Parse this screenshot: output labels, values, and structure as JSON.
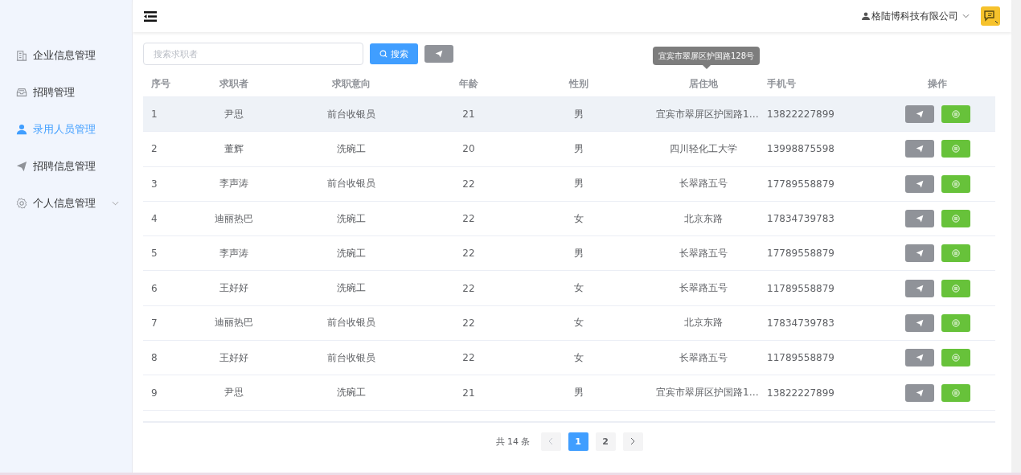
{
  "sidebar": {
    "items": [
      {
        "label": "企业信息管理",
        "selected": false
      },
      {
        "label": "招聘管理",
        "selected": false
      },
      {
        "label": "录用人员管理",
        "selected": true
      },
      {
        "label": "招聘信息管理",
        "selected": false
      },
      {
        "label": "个人信息管理",
        "selected": false,
        "expanded": false
      }
    ]
  },
  "header": {
    "company": "格陆博科技有限公司"
  },
  "search": {
    "placeholder": "搜索求职者",
    "button": "搜索"
  },
  "table": {
    "columns": [
      "序号",
      "求职者",
      "求职意向",
      "年龄",
      "性别",
      "居住地",
      "手机号",
      "操作"
    ],
    "rows": [
      {
        "cells": [
          "1",
          "尹思",
          "前台收银员",
          "21",
          "男",
          "宜宾市翠屏区护国路1…",
          "13822227899"
        ],
        "highlighted": true
      },
      {
        "cells": [
          "2",
          "董辉",
          "洗碗工",
          "20",
          "男",
          "四川轻化工大学",
          "13998875598"
        ],
        "highlighted": false
      },
      {
        "cells": [
          "3",
          "李声涛",
          "前台收银员",
          "22",
          "男",
          "长翠路五号",
          "17789558879"
        ],
        "highlighted": false
      },
      {
        "cells": [
          "4",
          "迪丽热巴",
          "洗碗工",
          "22",
          "女",
          "北京东路",
          "17834739783"
        ],
        "highlighted": false
      },
      {
        "cells": [
          "5",
          "李声涛",
          "洗碗工",
          "22",
          "男",
          "长翠路五号",
          "17789558879"
        ],
        "highlighted": false
      },
      {
        "cells": [
          "6",
          "王好好",
          "洗碗工",
          "22",
          "女",
          "长翠路五号",
          "11789558879"
        ],
        "highlighted": false
      },
      {
        "cells": [
          "7",
          "迪丽热巴",
          "前台收银员",
          "22",
          "女",
          "北京东路",
          "17834739783"
        ],
        "highlighted": false
      },
      {
        "cells": [
          "8",
          "王好好",
          "前台收银员",
          "22",
          "女",
          "长翠路五号",
          "11789558879"
        ],
        "highlighted": false
      },
      {
        "cells": [
          "9",
          "尹思",
          "洗碗工",
          "21",
          "男",
          "宜宾市翠屏区护国路1…",
          "13822227899"
        ],
        "highlighted": false
      }
    ],
    "tooltip": "宜宾市翠屏区护国路128号"
  },
  "pagination": {
    "total": "共 14 条",
    "pages": [
      {
        "label": "1",
        "selected": true
      },
      {
        "label": "2",
        "selected": false
      }
    ],
    "prev_disabled": true
  }
}
